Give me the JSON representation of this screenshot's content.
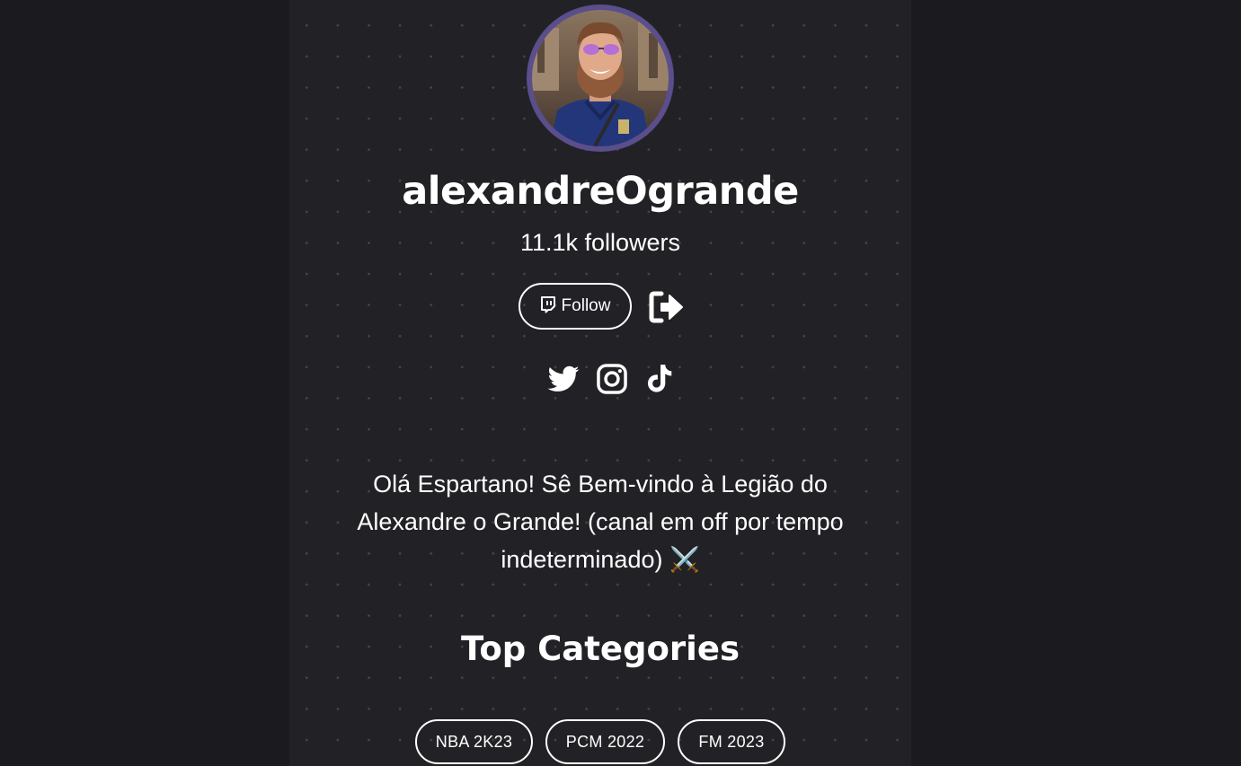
{
  "profile": {
    "username": "alexandreOgrande",
    "followers": "11.1k followers",
    "avatar_alt": "profile photo"
  },
  "actions": {
    "follow_label": "Follow",
    "follow_icon": "twitch-icon",
    "logout_icon": "sign-out-icon"
  },
  "socials": [
    {
      "icon": "twitter-icon"
    },
    {
      "icon": "instagram-icon"
    },
    {
      "icon": "tiktok-icon"
    }
  ],
  "bio": "Olá Espartano! Sê Bem-vindo à Legião do Alexandre o Grande! (canal em off por tempo indeterminado) ⚔️",
  "categories": {
    "title": "Top Categories",
    "items": [
      "NBA 2K23",
      "PCM 2022",
      "FM 2023"
    ]
  },
  "colors": {
    "background": "#1b1b1f",
    "column": "#222226",
    "avatar_ring": "#5a4e8c",
    "text": "#ffffff"
  }
}
